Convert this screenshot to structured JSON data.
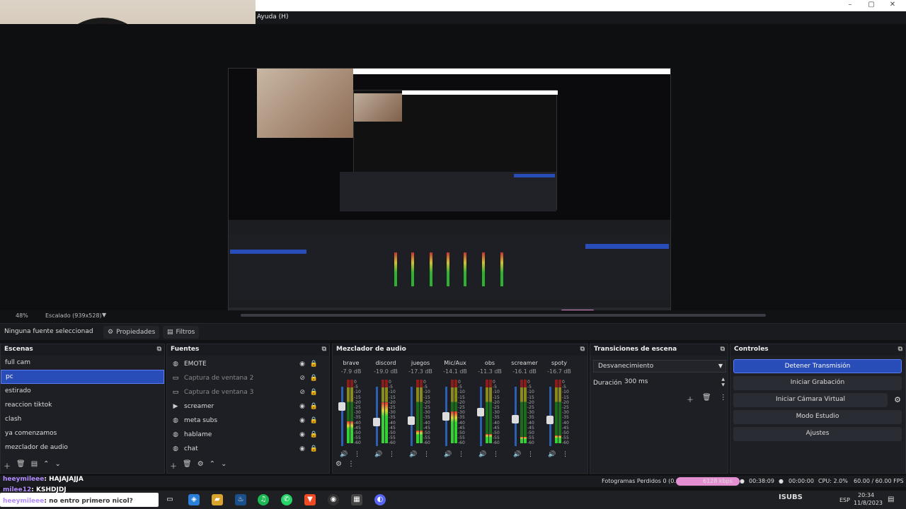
{
  "window": {
    "title": "Ayuda (H)",
    "controls": [
      "–",
      "▢",
      "✕"
    ]
  },
  "preview": {
    "zoom": "48%",
    "scale_label": "Escalado (939x528)"
  },
  "context_bar": {
    "no_source": "Ninguna fuente seleccionad",
    "properties": "Propiedades",
    "filters": "Filtros"
  },
  "scenes": {
    "title": "Escenas",
    "items": [
      "full cam",
      "pc",
      "estirado",
      "reaccion tiktok",
      "clash",
      "ya comenzamos",
      "mezclador de audio"
    ],
    "selected": "pc"
  },
  "sources": {
    "title": "Fuentes",
    "items": [
      {
        "label": "EMOTE",
        "icon": "globe-icon"
      },
      {
        "label": "Captura de ventana 2",
        "icon": "window-icon"
      },
      {
        "label": "Captura de ventana 3",
        "icon": "window-icon"
      },
      {
        "label": "screamer",
        "icon": "play-icon"
      },
      {
        "label": "meta subs",
        "icon": "globe-icon"
      },
      {
        "label": "hablame",
        "icon": "globe-icon"
      },
      {
        "label": "chat",
        "icon": "globe-icon"
      }
    ]
  },
  "mixer": {
    "title": "Mezclador de audio",
    "ticks": [
      "0",
      "-5",
      "-10",
      "-15",
      "-20",
      "-25",
      "-30",
      "-35",
      "-40",
      "-45",
      "-50",
      "-55",
      "-60"
    ],
    "channels": [
      {
        "name": "brave",
        "db": "-7.9 dB",
        "level": 0.72,
        "meter": 0.35
      },
      {
        "name": "discord",
        "db": "-19.0 dB",
        "level": 0.45,
        "meter": 0.65
      },
      {
        "name": "juegos",
        "db": "-17.3 dB",
        "level": 0.48,
        "meter": 0.2
      },
      {
        "name": "Mic/Aux",
        "db": "-14.1 dB",
        "level": 0.55,
        "meter": 0.5
      },
      {
        "name": "obs",
        "db": "-11.3 dB",
        "level": 0.62,
        "meter": 0.15
      },
      {
        "name": "screamer",
        "db": "-16.1 dB",
        "level": 0.5,
        "meter": 0.1
      },
      {
        "name": "spoty",
        "db": "-16.7 dB",
        "level": 0.49,
        "meter": 0.12
      }
    ]
  },
  "transitions": {
    "title": "Transiciones de escena",
    "selected": "Desvanecimiento",
    "duration_label": "Duración",
    "duration_value": "300 ms"
  },
  "controls": {
    "title": "Controles",
    "buttons": [
      "Detener Transmisión",
      "Iniciar Grabación",
      "Iniciar Cámara Virtual",
      "Modo Estudio",
      "Ajustes"
    ]
  },
  "status": {
    "dropped": "Fotogramas Perdidos 0 (0.0%)",
    "bitrate": "6128 kbps",
    "live_time": "00:38:09",
    "rec_time": "00:00:00",
    "cpu": "CPU: 2.0%",
    "fps": "60.00 / 60.00 FPS"
  },
  "chat": [
    {
      "user": "heeymileee",
      "msg": ": HAJAJAJJA"
    },
    {
      "user": "milee12",
      "msg": ": KSHDJDJ"
    },
    {
      "user": "heeymileee",
      "msg": ": no entro primero nicol?"
    }
  ],
  "taskbar": {
    "search": "Buscar",
    "lang": "ESP",
    "time": "20:34",
    "date": "11/8/2023",
    "subs": "ISUBS"
  }
}
